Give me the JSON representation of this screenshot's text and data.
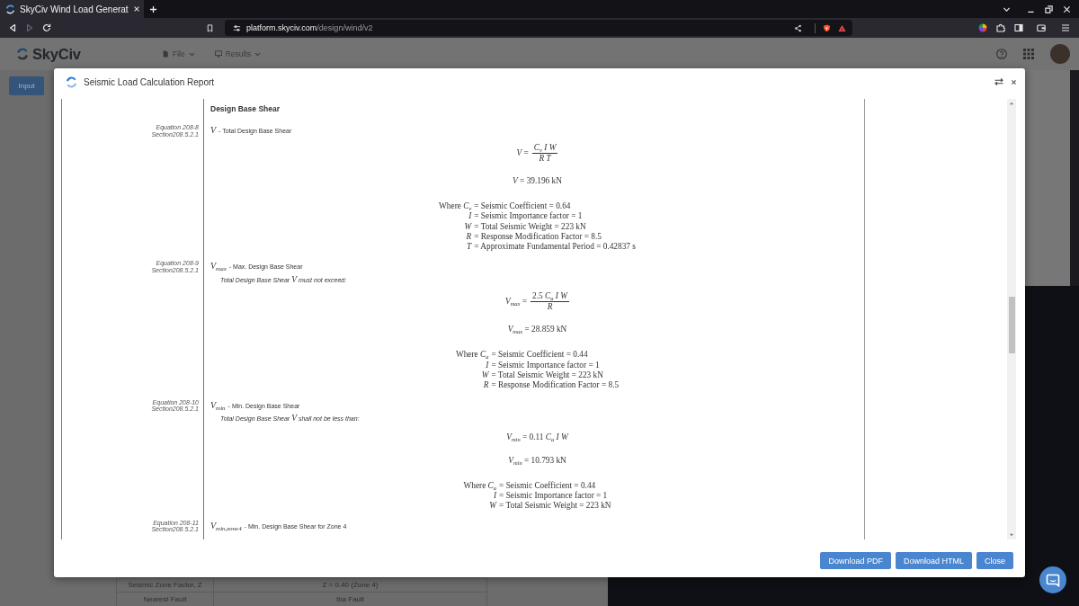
{
  "browser": {
    "tab": {
      "title": "SkyCiv Wind Load Generat"
    },
    "forward": {
      "disabled": true
    },
    "address": {
      "host": "platform.skyciv.com",
      "path": "/design/wind/v2"
    }
  },
  "app_header": {
    "logo": "SkyCiv",
    "menus": [
      {
        "label": "File",
        "kind": "file"
      },
      {
        "label": "Results",
        "kind": "results"
      }
    ]
  },
  "background": {
    "input_button": "Input",
    "table_rows": [
      {
        "label": "Seismic Zone Factor, Z",
        "value": "Z = 0.40 (Zone 4)"
      },
      {
        "label": "Nearest Fault",
        "value": "Iba Fault"
      }
    ]
  },
  "modal": {
    "title": "Seismic Load Calculation Report",
    "report": {
      "heading": "Design Base Shear",
      "entries": [
        {
          "equation_ref": "Equation 208-8",
          "section_ref": "Section208.5.2.1",
          "symbol": "*V*",
          "label": "- Total Design Base Shear",
          "formula": {
            "kind": "fraction",
            "lhs": "*V* =",
            "numerator": "*C*$_{v}$ *I W*",
            "denominator": "*R T*"
          },
          "result": "*V* = 39.196 kN",
          "where": [
            {
              "symbol": "Where *C*$_{v}$",
              "text": "= Seismic Coefficient = 0.64"
            },
            {
              "symbol": "*I*",
              "text": "= Seismic Importance factor = 1"
            },
            {
              "symbol": "*W*",
              "text": "= Total Seismic Weight = 223 kN"
            },
            {
              "symbol": "*R*",
              "text": "= Response Modification Factor = 8.5"
            },
            {
              "symbol": "*T*",
              "text": "= Approximate Fundamental Period = 0.42837 s"
            }
          ]
        },
        {
          "equation_ref": "Equation 208-9",
          "section_ref": "Section208.5.2.1",
          "symbol": "*V*$_{max}$",
          "label": "- Max. Design Base Shear",
          "note": {
            "before": "Total Design Base Shear",
            "symbol": "V",
            "after": "must not exceed:"
          },
          "formula": {
            "kind": "fraction",
            "lhs": "*V*$_{max}$ =",
            "numerator": "2.5 *C*$_{a}$ *I W*",
            "denominator": "*R*"
          },
          "result": "*V*$_{max}$ = 28.859 kN",
          "where": [
            {
              "symbol": "Where *C*$_{a}$",
              "text": "= Seismic Coefficient = 0.44"
            },
            {
              "symbol": "*I*",
              "text": "= Seismic Importance factor = 1"
            },
            {
              "symbol": "*W*",
              "text": "= Total Seismic Weight = 223 kN"
            },
            {
              "symbol": "*R*",
              "text": "= Response Modification Factor = 8.5"
            }
          ]
        },
        {
          "equation_ref": "Equation 208-10",
          "section_ref": "Section208.5.2.1",
          "symbol": "*V*$_{min}$",
          "label": "- Min. Design Base Shear",
          "note": {
            "before": "Total Design Base Shear",
            "symbol": "V",
            "after": "shall not be less than:"
          },
          "formula": {
            "kind": "inline",
            "expression": "*V*$_{min}$ = 0.11 *C*$_{a}$ *I W*"
          },
          "result": "*V*$_{min}$ = 10.793 kN",
          "where": [
            {
              "symbol": "Where *C*$_{a}$",
              "text": "= Seismic Coefficient = 0.44"
            },
            {
              "symbol": "*I*",
              "text": "= Seismic Importance factor = 1"
            },
            {
              "symbol": "*W*",
              "text": "= Total Seismic Weight = 223 kN"
            }
          ]
        },
        {
          "equation_ref": "Equation 208-11",
          "section_ref": "Section208.5.2.1",
          "symbol": "*V*$_{min,zone4}$",
          "label": "- Min. Design Base Shear for Zone 4"
        }
      ]
    },
    "buttons": [
      {
        "label": "Download PDF"
      },
      {
        "label": "Download HTML"
      },
      {
        "label": "Close"
      }
    ]
  }
}
